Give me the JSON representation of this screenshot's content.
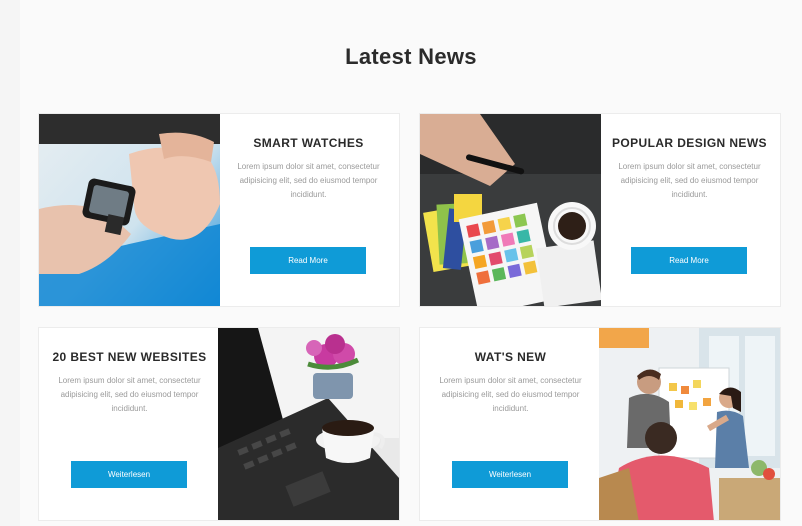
{
  "section": {
    "title": "Latest News"
  },
  "cards": [
    {
      "title": "SMART WATCHES",
      "body": "Lorem ipsum dolor sit amet, consectetur adipisicing elit, sed do eiusmod tempor incididunt.",
      "button_label": "Read More",
      "image_icon": "smartwatch-photo-icon"
    },
    {
      "title": "POPULAR DESIGN NEWS",
      "body": "Lorem ipsum dolor sit amet, consectetur adipisicing elit, sed do eiusmod tempor incididunt.",
      "button_label": "Read More",
      "image_icon": "design-swatches-photo-icon"
    },
    {
      "title": "20 BEST NEW WEBSITES",
      "body": "Lorem ipsum dolor sit amet, consectetur adipisicing elit, sed do eiusmod tempor incididunt.",
      "button_label": "Weiterlesen",
      "image_icon": "laptop-coffee-photo-icon"
    },
    {
      "title": "WAT'S NEW",
      "body": "Lorem ipsum dolor sit amet, consectetur adipisicing elit, sed do eiusmod tempor incididunt.",
      "button_label": "Weiterlesen",
      "image_icon": "team-meeting-photo-icon"
    }
  ],
  "colors": {
    "button": "#0f9bd7",
    "title": "#2b2b2b",
    "body_text": "#9a9a9a"
  }
}
